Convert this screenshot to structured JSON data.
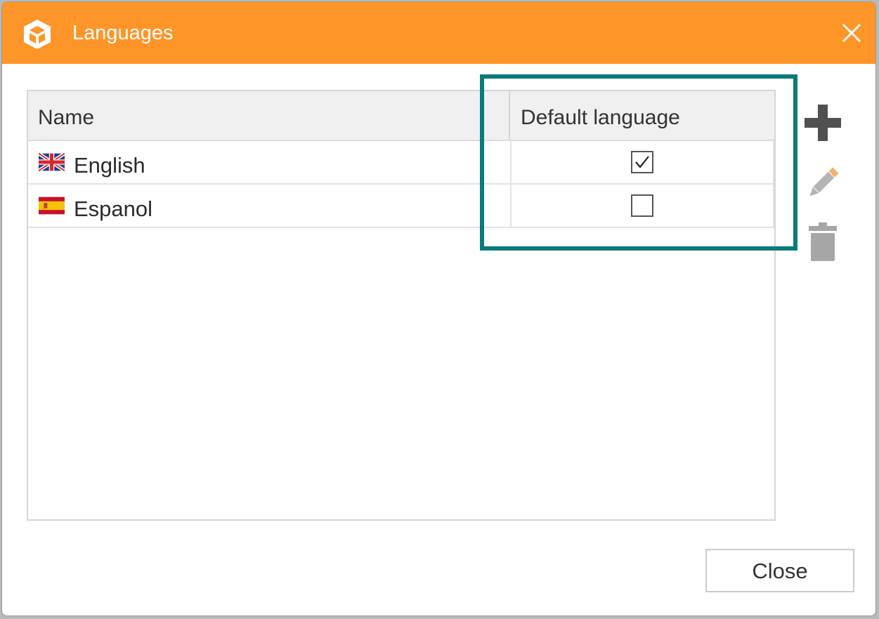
{
  "dialog": {
    "title": "Languages",
    "accent_color": "#fe9529",
    "highlight_color": "#0b7a7a"
  },
  "table": {
    "columns": [
      "Name",
      "Default language"
    ],
    "rows": [
      {
        "name": "English",
        "flag": "uk-flag-icon",
        "default": true
      },
      {
        "name": "Espanol",
        "flag": "spain-flag-icon",
        "default": false
      }
    ]
  },
  "toolbar": {
    "add_icon": "plus-icon",
    "edit_icon": "pencil-icon",
    "delete_icon": "trash-icon"
  },
  "footer": {
    "close_label": "Close"
  }
}
